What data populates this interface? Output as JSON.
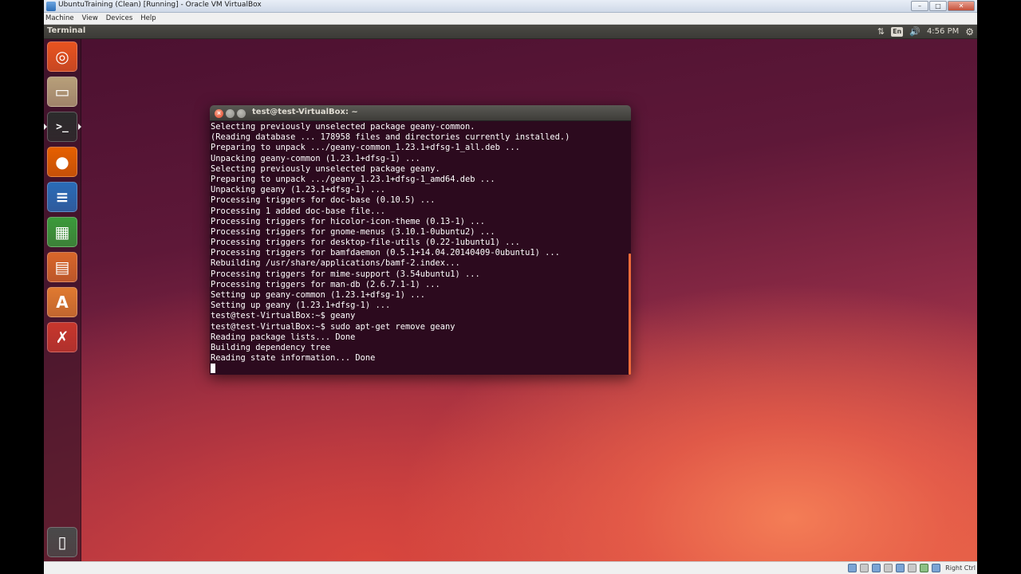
{
  "vbox": {
    "window_title": "UbuntuTraining (Clean) [Running] - Oracle VM VirtualBox",
    "controls": {
      "minimize": "–",
      "maximize": "□",
      "close": "✕"
    },
    "menu": [
      "Machine",
      "View",
      "Devices",
      "Help"
    ],
    "host_key": "Right Ctrl"
  },
  "panel": {
    "app_name": "Terminal",
    "lang": "En",
    "time": "4:56 PM",
    "network_glyph": "⇅",
    "volume_glyph": "🔊",
    "gear_glyph": "⚙"
  },
  "launcher": {
    "items": [
      {
        "name": "dash-home",
        "icon": "ubuntu-logo-icon",
        "glyph": "◎",
        "bg": "#e95420"
      },
      {
        "name": "files",
        "icon": "file-manager-icon",
        "glyph": "▭",
        "bg": "#b8a07a"
      },
      {
        "name": "terminal",
        "icon": "terminal-icon",
        "glyph": ">_",
        "bg": "#2c2c2c",
        "active": true
      },
      {
        "name": "firefox",
        "icon": "firefox-icon",
        "glyph": "●",
        "bg": "#e66000"
      },
      {
        "name": "writer",
        "icon": "libreoffice-writer-icon",
        "glyph": "≡",
        "bg": "#2a6cb8"
      },
      {
        "name": "calc",
        "icon": "libreoffice-calc-icon",
        "glyph": "▦",
        "bg": "#3b9b3b"
      },
      {
        "name": "impress",
        "icon": "libreoffice-impress-icon",
        "glyph": "▤",
        "bg": "#d9672a"
      },
      {
        "name": "software-center",
        "icon": "software-center-icon",
        "glyph": "A",
        "bg": "#e07a30"
      },
      {
        "name": "system-settings",
        "icon": "system-settings-icon",
        "glyph": "✗",
        "bg": "#c8372d"
      },
      {
        "name": "trash",
        "icon": "trash-icon",
        "glyph": "▯",
        "bg": "#4a4a4a"
      }
    ]
  },
  "terminal": {
    "title": "test@test-VirtualBox: ~",
    "lines": [
      "Selecting previously unselected package geany-common.",
      "(Reading database ... 178958 files and directories currently installed.)",
      "Preparing to unpack .../geany-common_1.23.1+dfsg-1_all.deb ...",
      "Unpacking geany-common (1.23.1+dfsg-1) ...",
      "Selecting previously unselected package geany.",
      "Preparing to unpack .../geany_1.23.1+dfsg-1_amd64.deb ...",
      "Unpacking geany (1.23.1+dfsg-1) ...",
      "Processing triggers for doc-base (0.10.5) ...",
      "Processing 1 added doc-base file...",
      "Processing triggers for hicolor-icon-theme (0.13-1) ...",
      "Processing triggers for gnome-menus (3.10.1-0ubuntu2) ...",
      "Processing triggers for desktop-file-utils (0.22-1ubuntu1) ...",
      "Processing triggers for bamfdaemon (0.5.1+14.04.20140409-0ubuntu1) ...",
      "Rebuilding /usr/share/applications/bamf-2.index...",
      "Processing triggers for mime-support (3.54ubuntu1) ...",
      "Processing triggers for man-db (2.6.7.1-1) ...",
      "Setting up geany-common (1.23.1+dfsg-1) ...",
      "Setting up geany (1.23.1+dfsg-1) ...",
      "test@test-VirtualBox:~$ geany",
      "test@test-VirtualBox:~$ sudo apt-get remove geany",
      "Reading package lists... Done",
      "Building dependency tree",
      "Reading state information... Done"
    ]
  }
}
